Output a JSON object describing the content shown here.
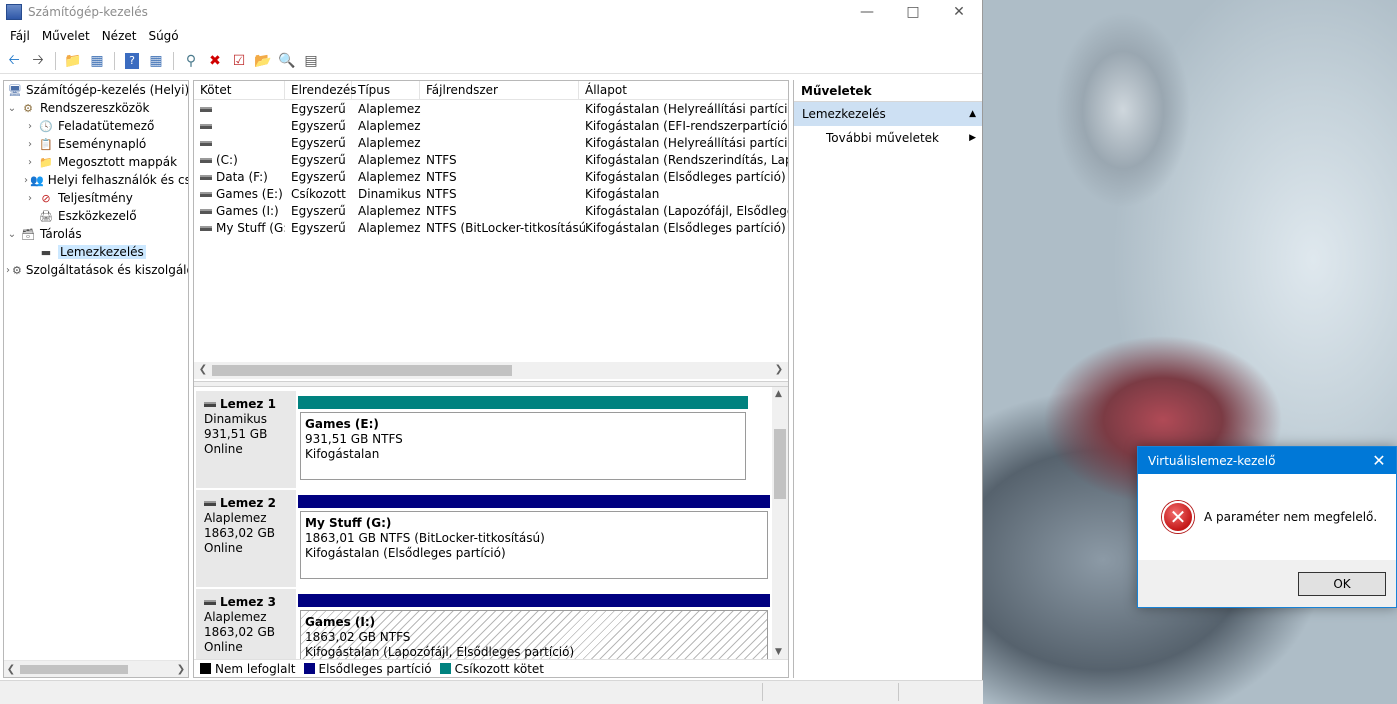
{
  "window": {
    "title": "Számítógép-kezelés"
  },
  "menu": [
    "Fájl",
    "Művelet",
    "Nézet",
    "Súgó"
  ],
  "toolbar": {
    "icons": [
      "back-arrow-icon",
      "forward-arrow-icon",
      "up-folder-icon",
      "show-hide-tree-icon",
      "help-icon",
      "console-icon",
      "connect-icon",
      "delete-icon",
      "properties-icon",
      "open-icon",
      "search-icon",
      "extra-icon"
    ],
    "colors": {
      "delete": "#d00000",
      "back": "#1b75c9"
    }
  },
  "tree": [
    {
      "label": "Számítógép-kezelés (Helyi)",
      "level": 0,
      "expander": "",
      "icon": "computer-management-icon"
    },
    {
      "label": "Rendszereszközök",
      "level": 0,
      "expander": "v",
      "icon": "system-tools-icon"
    },
    {
      "label": "Feladatütemező",
      "level": 1,
      "expander": ">",
      "icon": "clock-icon"
    },
    {
      "label": "Eseménynapló",
      "level": 1,
      "expander": ">",
      "icon": "event-log-icon"
    },
    {
      "label": "Megosztott mappák",
      "level": 1,
      "expander": ">",
      "icon": "shared-folder-icon"
    },
    {
      "label": "Helyi felhasználók és cs",
      "level": 1,
      "expander": ">",
      "icon": "users-icon"
    },
    {
      "label": "Teljesítmény",
      "level": 1,
      "expander": ">",
      "icon": "performance-icon"
    },
    {
      "label": "Eszközkezelő",
      "level": 1,
      "expander": "",
      "icon": "device-manager-icon"
    },
    {
      "label": "Tárolás",
      "level": 0,
      "expander": "v",
      "icon": "storage-icon"
    },
    {
      "label": "Lemezkezelés",
      "level": 1,
      "expander": "",
      "icon": "disk-management-icon",
      "selected": true
    },
    {
      "label": "Szolgáltatások és kiszolgáló",
      "level": 0,
      "expander": ">",
      "icon": "services-icon"
    }
  ],
  "volume_list": {
    "columns": [
      "Kötet",
      "Elrendezés",
      "Típus",
      "Fájlrendszer",
      "Állapot"
    ],
    "rows": [
      [
        "",
        "Egyszerű",
        "Alaplemez",
        "",
        "Kifogástalan (Helyreállítási partíció)"
      ],
      [
        "",
        "Egyszerű",
        "Alaplemez",
        "",
        "Kifogástalan (EFI-rendszerpartíció)"
      ],
      [
        "",
        "Egyszerű",
        "Alaplemez",
        "",
        "Kifogástalan (Helyreállítási partíció)"
      ],
      [
        "(C:)",
        "Egyszerű",
        "Alaplemez",
        "NTFS",
        "Kifogástalan (Rendszerindítás, Lapozóf"
      ],
      [
        "Data (F:)",
        "Egyszerű",
        "Alaplemez",
        "NTFS",
        "Kifogástalan (Elsődleges partíció)"
      ],
      [
        "Games (E:)",
        "Csíkozott",
        "Dinamikus",
        "NTFS",
        "Kifogástalan"
      ],
      [
        "Games (I:)",
        "Egyszerű",
        "Alaplemez",
        "NTFS",
        "Kifogástalan (Lapozófájl, Elsődleges pa"
      ],
      [
        "My Stuff (G:)",
        "Egyszerű",
        "Alaplemez",
        "NTFS (BitLocker-titkosítású)",
        "Kifogástalan (Elsődleges partíció)"
      ]
    ]
  },
  "disks": [
    {
      "name": "Lemez 1",
      "type": "Dinamikus",
      "size": "931,51 GB",
      "status": "Online",
      "partition": {
        "name": "Games  (E:)",
        "detail": "931,51 GB NTFS",
        "state": "Kifogástalan",
        "bar_color": "#00827f",
        "hatched": false
      }
    },
    {
      "name": "Lemez 2",
      "type": "Alaplemez",
      "size": "1863,02 GB",
      "status": "Online",
      "partition": {
        "name": "My Stuff  (G:)",
        "detail": "1863,01 GB NTFS (BitLocker-titkosítású)",
        "state": "Kifogástalan (Elsődleges partíció)",
        "bar_color": "#000080",
        "hatched": false
      }
    },
    {
      "name": "Lemez 3",
      "type": "Alaplemez",
      "size": "1863,02 GB",
      "status": "Online",
      "partition": {
        "name": "Games  (I:)",
        "detail": "1863,02 GB NTFS",
        "state": "Kifogástalan (Lapozófájl, Elsődleges partíció)",
        "bar_color": "#000080",
        "hatched": true
      }
    }
  ],
  "legend": [
    {
      "label": "Nem lefoglalt",
      "color": "#000000"
    },
    {
      "label": "Elsődleges partíció",
      "color": "#000080"
    },
    {
      "label": "Csíkozott kötet",
      "color": "#00827f"
    }
  ],
  "actions": {
    "header": "Műveletek",
    "section": "Lemezkezelés",
    "items": [
      "További műveletek"
    ]
  },
  "dialog": {
    "title": "Virtuálislemez-kezelő",
    "message": "A paraméter nem megfelelő.",
    "ok": "OK"
  }
}
